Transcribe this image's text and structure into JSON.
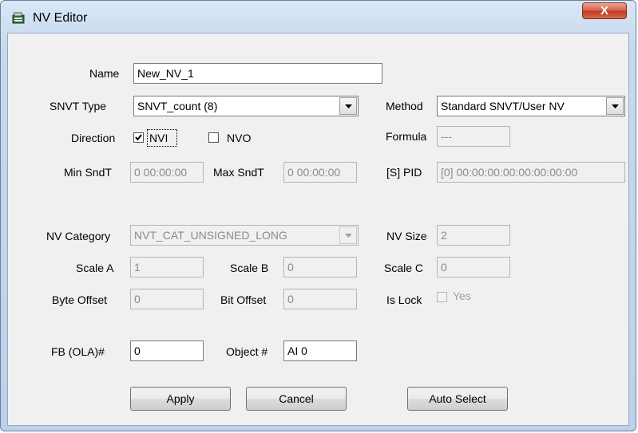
{
  "window": {
    "title": "NV Editor",
    "close_label": "X"
  },
  "form": {
    "name": {
      "label": "Name",
      "value": "New_NV_1"
    },
    "snvt_type": {
      "label": "SNVT Type",
      "value": "SNVT_count (8)"
    },
    "method": {
      "label": "Method",
      "value": "Standard SNVT/User NV"
    },
    "direction": {
      "label": "Direction",
      "nvi_label": "NVI",
      "nvi_checked": true,
      "nvo_label": "NVO",
      "nvo_checked": false
    },
    "formula": {
      "label": "Formula",
      "value": "---"
    },
    "min_sndt": {
      "label": "Min SndT",
      "value": "0 00:00:00"
    },
    "max_sndt": {
      "label": "Max SndT",
      "value": "0 00:00:00"
    },
    "s_pid": {
      "label": "[S] PID",
      "value": "[0] 00:00:00:00:00:00:00:00"
    },
    "nv_category": {
      "label": "NV Category",
      "value": "NVT_CAT_UNSIGNED_LONG"
    },
    "nv_size": {
      "label": "NV Size",
      "value": "2"
    },
    "scale_a": {
      "label": "Scale A",
      "value": "1"
    },
    "scale_b": {
      "label": "Scale B",
      "value": "0"
    },
    "scale_c": {
      "label": "Scale C",
      "value": "0"
    },
    "byte_offset": {
      "label": "Byte Offset",
      "value": "0"
    },
    "bit_offset": {
      "label": "Bit Offset",
      "value": "0"
    },
    "is_lock": {
      "label": "Is Lock",
      "checkbox_label": "Yes",
      "checked": false
    },
    "fb_ola": {
      "label": "FB (OLA)#",
      "value": "0"
    },
    "object_num": {
      "label": "Object #",
      "value": "AI 0"
    }
  },
  "buttons": {
    "apply": "Apply",
    "cancel": "Cancel",
    "auto_select": "Auto Select"
  }
}
